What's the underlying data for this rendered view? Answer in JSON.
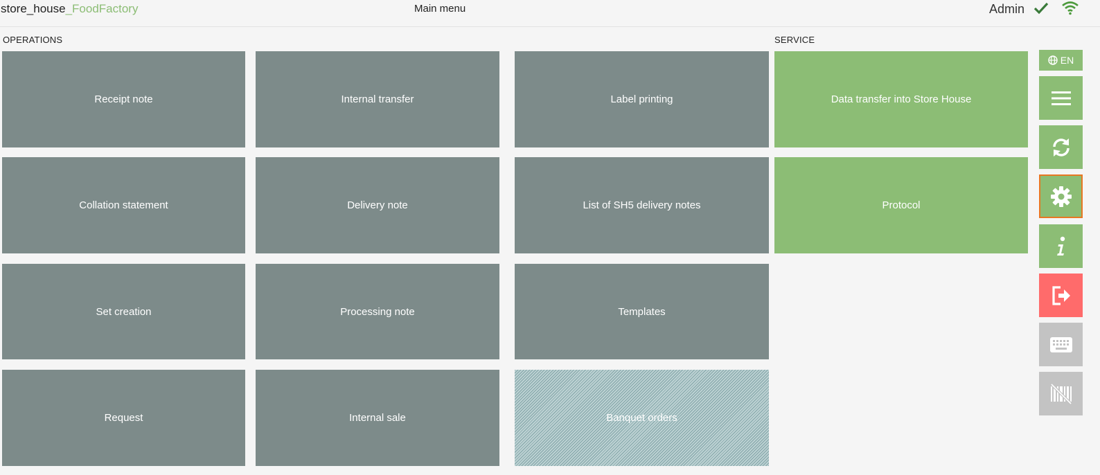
{
  "header": {
    "app_name": "store_house",
    "app_suffix": "_FoodFactory",
    "title": "Main menu",
    "user": "Admin",
    "status_icon": "check-icon",
    "connection_icon": "wifi-icon"
  },
  "sections": {
    "operations": "OPERATIONS",
    "service": "SERVICE"
  },
  "tiles": {
    "receipt_note": "Receipt note",
    "internal_transfer": "Internal transfer",
    "label_printing": "Label printing",
    "collation_statement": "Collation statement",
    "delivery_note": "Delivery note",
    "list_sh5": "List of SH5 delivery notes",
    "set_creation": "Set creation",
    "processing_note": "Processing note",
    "templates": "Templates",
    "request": "Request",
    "internal_sale": "Internal sale",
    "banquet_orders": "Banquet orders",
    "data_transfer": "Data transfer into Store House",
    "protocol": "Protocol"
  },
  "sidebar": {
    "language": "EN",
    "icons": [
      "globe-icon",
      "menu-icon",
      "sync-icon",
      "gear-icon",
      "info-icon",
      "logout-icon",
      "keyboard-icon",
      "barcode-off-icon"
    ]
  },
  "colors": {
    "tile_gray": "#7d8b8a",
    "accent_green": "#8cbd75",
    "logout_red": "#ff6b6b",
    "disabled_gray": "#c3c3c3",
    "selected_border": "#e87722"
  }
}
